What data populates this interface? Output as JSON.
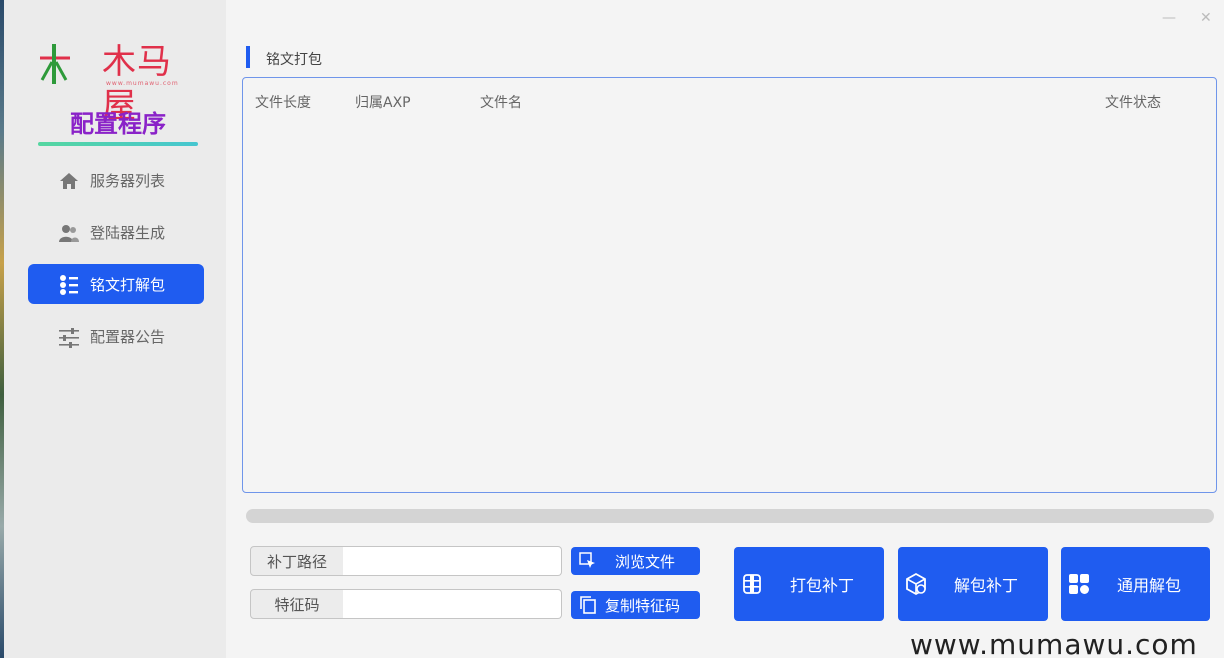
{
  "sidebar": {
    "logo_text": "木马屋",
    "logo_sub": "www.mumawu.com",
    "app_title": "配置程序",
    "items": [
      {
        "label": "服务器列表",
        "icon": "home-icon",
        "active": false
      },
      {
        "label": "登陆器生成",
        "icon": "users-icon",
        "active": false
      },
      {
        "label": "铭文打解包",
        "icon": "list-icon",
        "active": true
      },
      {
        "label": "配置器公告",
        "icon": "sliders-icon",
        "active": false
      }
    ]
  },
  "window": {
    "minimize": "—",
    "close": "✕"
  },
  "main": {
    "section_title": "铭文打包",
    "table": {
      "columns": [
        "文件长度",
        "归属AXP",
        "文件名",
        "文件状态"
      ],
      "rows": []
    },
    "progress": 0,
    "fields": {
      "patch_path_label": "补丁路径",
      "patch_path_value": "",
      "feature_code_label": "特征码",
      "feature_code_value": ""
    },
    "buttons": {
      "browse": "浏览文件",
      "copy_code": "复制特征码",
      "pack": "打包补丁",
      "unpack": "解包补丁",
      "general_unpack": "通用解包"
    }
  },
  "watermark": "www.mumawu.com",
  "colors": {
    "accent": "#1f5cf0",
    "title_purple": "#8a22c8",
    "logo_red": "#e0304a",
    "logo_green": "#2e9a3a"
  }
}
